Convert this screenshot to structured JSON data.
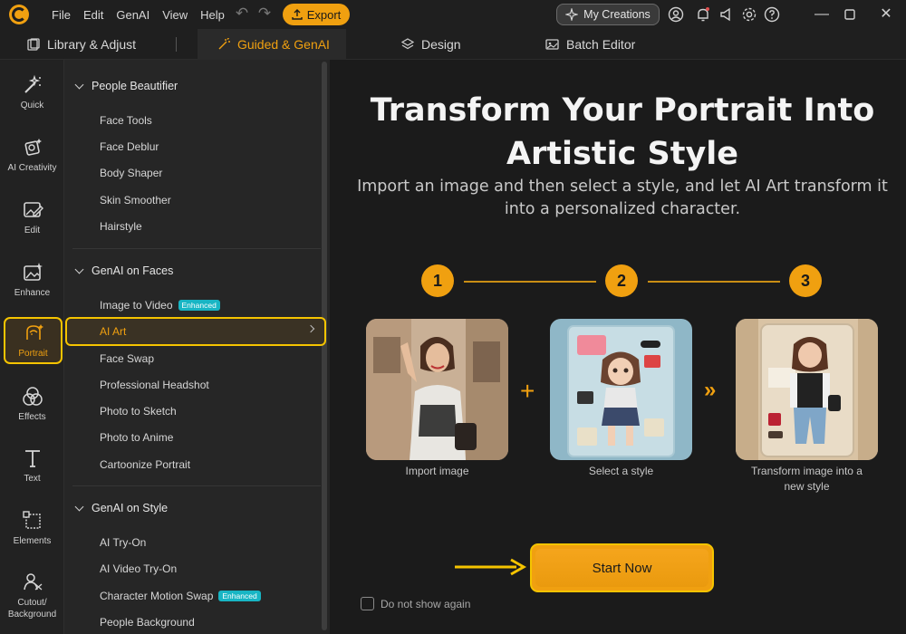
{
  "menu": [
    "File",
    "Edit",
    "GenAI",
    "View",
    "Help"
  ],
  "toolbar": {
    "export_label": "Export",
    "my_creations_label": "My Creations"
  },
  "tabs": [
    {
      "label": "Library & Adjust",
      "icon": "library-icon"
    },
    {
      "label": "Guided & GenAI",
      "icon": "magic-wand-icon",
      "active": true
    },
    {
      "label": "Design",
      "icon": "layers-icon"
    },
    {
      "label": "Batch Editor",
      "icon": "batch-images-icon"
    }
  ],
  "rail": [
    {
      "label": "Quick",
      "icon": "wand-stars-icon"
    },
    {
      "label": "AI Creativity",
      "icon": "ai-creativity-icon"
    },
    {
      "label": "Edit",
      "icon": "edit-image-icon"
    },
    {
      "label": "Enhance",
      "icon": "enhance-icon"
    },
    {
      "label": "Portrait",
      "icon": "portrait-face-icon",
      "active": true
    },
    {
      "label": "Effects",
      "icon": "effects-circles-icon"
    },
    {
      "label": "Text",
      "icon": "text-icon"
    },
    {
      "label": "Elements",
      "icon": "elements-icon"
    },
    {
      "label": "Cutout/\nBackground",
      "icon": "cutout-icon"
    }
  ],
  "panel": {
    "sections": [
      {
        "title": "People Beautifier",
        "items": [
          {
            "label": "Face Tools"
          },
          {
            "label": "Face Deblur"
          },
          {
            "label": "Body Shaper"
          },
          {
            "label": "Skin Smoother"
          },
          {
            "label": "Hairstyle"
          }
        ]
      },
      {
        "title": "GenAI on Faces",
        "items": [
          {
            "label": "Image to Video",
            "badge": "Enhanced"
          },
          {
            "label": "AI Art",
            "active": true
          },
          {
            "label": "Face Swap"
          },
          {
            "label": "Professional Headshot"
          },
          {
            "label": "Photo to Sketch"
          },
          {
            "label": "Photo to Anime"
          },
          {
            "label": "Cartoonize Portrait"
          }
        ]
      },
      {
        "title": "GenAI on Style",
        "items": [
          {
            "label": "AI Try-On"
          },
          {
            "label": "AI Video Try-On"
          },
          {
            "label": "Character Motion Swap",
            "badge": "Enhanced"
          },
          {
            "label": "People Background"
          }
        ]
      }
    ]
  },
  "main": {
    "title_line1": "Transform Your Portrait Into",
    "title_line2": "Artistic Style",
    "subtitle_line1": "Import an image and then select a style, and let AI Art transform it",
    "subtitle_line2": "into a personalized character.",
    "steps": [
      {
        "num": "1",
        "caption_line1": "Import image",
        "caption_line2": ""
      },
      {
        "num": "2",
        "caption_line1": "Select a style",
        "caption_line2": ""
      },
      {
        "num": "3",
        "caption_line1": "Transform image into a",
        "caption_line2": "new style"
      }
    ],
    "plus_symbol": "+",
    "next_symbol": "»",
    "start_label": "Start Now",
    "checkbox_label": "Do not show again"
  },
  "colors": {
    "accent": "#f0a010",
    "highlight": "#f5c400",
    "badge": "#18b5c4"
  }
}
